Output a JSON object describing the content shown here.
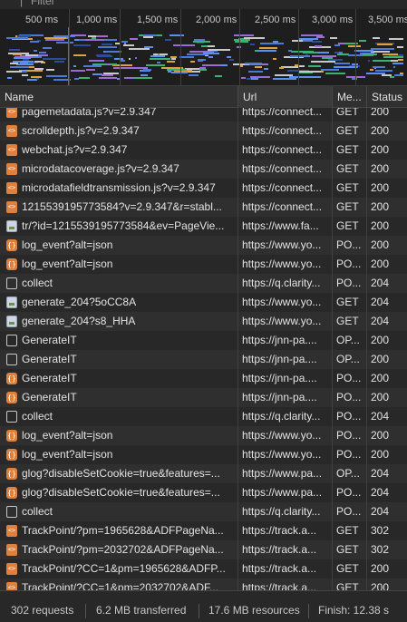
{
  "filter": {
    "label": "Filter"
  },
  "timeline": {
    "ticks": [
      "500 ms",
      "1,000 ms",
      "1,500 ms",
      "2,000 ms",
      "2,500 ms",
      "3,000 ms",
      "3,500 ms"
    ]
  },
  "columns": {
    "name": "Name",
    "url": "Url",
    "method": "Me...",
    "status": "Status"
  },
  "requests": [
    {
      "icon": "script-file-icon",
      "name": "pagemetadata.js?v=2.9.347",
      "url": "https://connect...",
      "method": "GET",
      "status": "200"
    },
    {
      "icon": "script-file-icon",
      "name": "scrolldepth.js?v=2.9.347",
      "url": "https://connect...",
      "method": "GET",
      "status": "200"
    },
    {
      "icon": "script-file-icon",
      "name": "webchat.js?v=2.9.347",
      "url": "https://connect...",
      "method": "GET",
      "status": "200"
    },
    {
      "icon": "script-file-icon",
      "name": "microdatacoverage.js?v=2.9.347",
      "url": "https://connect...",
      "method": "GET",
      "status": "200"
    },
    {
      "icon": "script-file-icon",
      "name": "microdatafieldtransmission.js?v=2.9.347",
      "url": "https://connect...",
      "method": "GET",
      "status": "200"
    },
    {
      "icon": "script-file-icon",
      "name": "1215539195773584?v=2.9.347&r=stabl...",
      "url": "https://connect...",
      "method": "GET",
      "status": "200"
    },
    {
      "icon": "image-file-icon",
      "name": "tr/?id=1215539195773584&ev=PageVie...",
      "url": "https://www.fa...",
      "method": "GET",
      "status": "200"
    },
    {
      "icon": "fetch-xhr-icon",
      "name": "log_event?alt=json",
      "url": "https://www.yo...",
      "method": "PO...",
      "status": "200"
    },
    {
      "icon": "fetch-xhr-icon",
      "name": "log_event?alt=json",
      "url": "https://www.yo...",
      "method": "PO...",
      "status": "200"
    },
    {
      "icon": "document-icon",
      "name": "collect",
      "url": "https://q.clarity...",
      "method": "PO...",
      "status": "204"
    },
    {
      "icon": "image-file-icon",
      "name": "generate_204?5oCC8A",
      "url": "https://www.yo...",
      "method": "GET",
      "status": "204"
    },
    {
      "icon": "image-file-icon",
      "name": "generate_204?s8_HHA",
      "url": "https://www.yo...",
      "method": "GET",
      "status": "204"
    },
    {
      "icon": "document-icon",
      "name": "GenerateIT",
      "url": "https://jnn-pa....",
      "method": "OP...",
      "status": "200"
    },
    {
      "icon": "document-icon",
      "name": "GenerateIT",
      "url": "https://jnn-pa....",
      "method": "OP...",
      "status": "200"
    },
    {
      "icon": "fetch-xhr-icon",
      "name": "GenerateIT",
      "url": "https://jnn-pa....",
      "method": "PO...",
      "status": "200"
    },
    {
      "icon": "fetch-xhr-icon",
      "name": "GenerateIT",
      "url": "https://jnn-pa....",
      "method": "PO...",
      "status": "200"
    },
    {
      "icon": "document-icon",
      "name": "collect",
      "url": "https://q.clarity...",
      "method": "PO...",
      "status": "204"
    },
    {
      "icon": "fetch-xhr-icon",
      "name": "log_event?alt=json",
      "url": "https://www.yo...",
      "method": "PO...",
      "status": "200"
    },
    {
      "icon": "fetch-xhr-icon",
      "name": "log_event?alt=json",
      "url": "https://www.yo...",
      "method": "PO...",
      "status": "200"
    },
    {
      "icon": "fetch-xhr-icon",
      "name": "glog?disableSetCookie=true&features=...",
      "url": "https://www.pa...",
      "method": "OP...",
      "status": "204"
    },
    {
      "icon": "fetch-xhr-icon",
      "name": "glog?disableSetCookie=true&features=...",
      "url": "https://www.pa...",
      "method": "PO...",
      "status": "204"
    },
    {
      "icon": "document-icon",
      "name": "collect",
      "url": "https://q.clarity...",
      "method": "PO...",
      "status": "204"
    },
    {
      "icon": "script-file-icon",
      "name": "TrackPoint/?pm=1965628&ADFPageNa...",
      "url": "https://track.a...",
      "method": "GET",
      "status": "302"
    },
    {
      "icon": "script-file-icon",
      "name": "TrackPoint/?pm=2032702&ADFPageNa...",
      "url": "https://track.a...",
      "method": "GET",
      "status": "302"
    },
    {
      "icon": "script-file-icon",
      "name": "TrackPoint/?CC=1&pm=1965628&ADFP...",
      "url": "https://track.a...",
      "method": "GET",
      "status": "200"
    },
    {
      "icon": "script-file-icon",
      "name": "TrackPoint/?CC=1&pm=2032702&ADF...",
      "url": "https://track.a...",
      "method": "GET",
      "status": "200"
    }
  ],
  "summary": {
    "requests": "302 requests",
    "transferred": "6.2 MB transferred",
    "resources": "17.6 MB resources",
    "finish": "Finish: 12.38 s"
  }
}
